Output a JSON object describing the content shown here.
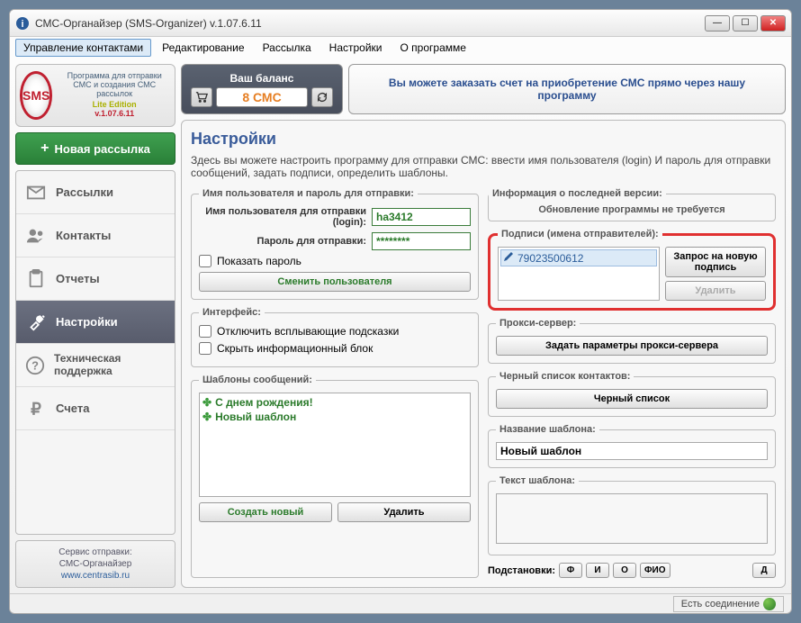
{
  "window": {
    "title": "СМС-Органайзер (SMS-Organizer) v.1.07.6.11"
  },
  "menu": {
    "contacts": "Управление контактами",
    "edit": "Редактирование",
    "send": "Рассылка",
    "settings": "Настройки",
    "about": "О программе"
  },
  "sidebar": {
    "logo": {
      "badge": "SMS",
      "desc": "Программа для отправки СМС и создания СМС рассылок",
      "edition": "Lite Edition",
      "version": "v.1.07.6.11"
    },
    "new_campaign": "Новая рассылка",
    "items": [
      {
        "label": "Рассылки"
      },
      {
        "label": "Контакты"
      },
      {
        "label": "Отчеты"
      },
      {
        "label": "Настройки"
      },
      {
        "label": "Техническая поддержка"
      },
      {
        "label": "Счета"
      }
    ],
    "service": {
      "l1": "Сервис отправки:",
      "l2": "СМС-Органайзер",
      "l3": "www.centrasib.ru"
    }
  },
  "top": {
    "balance_label": "Ваш баланс",
    "balance_value": "8 СМС",
    "order_text": "Вы можете заказать счет на приобретение СМС прямо через нашу программу"
  },
  "settings": {
    "heading": "Настройки",
    "desc": "Здесь вы можете настроить программу для отправки СМС: ввести имя пользователя (login) И пароль для отправки сообщений, задать подписи, определить шаблоны.",
    "creds": {
      "legend": "Имя пользователя и пароль для отправки:",
      "login_label": "Имя пользователя для отправки (login):",
      "login_value": "ha3412",
      "pass_label": "Пароль для отправки:",
      "pass_value": "********",
      "show_pass": "Показать пароль",
      "change_user": "Сменить пользователя"
    },
    "ui": {
      "legend": "Интерфейс:",
      "disable_tips": "Отключить всплывающие подсказки",
      "hide_info": "Скрыть информационный блок"
    },
    "templates": {
      "legend": "Шаблоны сообщений:",
      "items": [
        "С днем рождения!",
        "Новый шаблон"
      ],
      "create": "Создать новый",
      "delete": "Удалить"
    },
    "version": {
      "legend": "Информация о последней версии:",
      "text": "Обновление программы не требуется"
    },
    "signatures": {
      "legend": "Подписи (имена отправителей):",
      "items": [
        "79023500612"
      ],
      "request": "Запрос на новую подпись",
      "delete": "Удалить"
    },
    "proxy": {
      "legend": "Прокси-сервер:",
      "btn": "Задать параметры прокси-сервера"
    },
    "blacklist": {
      "legend": "Черный список контактов:",
      "btn": "Черный список"
    },
    "tpl_name": {
      "legend": "Название шаблона:",
      "value": "Новый шаблон"
    },
    "tpl_text": {
      "legend": "Текст шаблона:"
    },
    "subst": {
      "label": "Подстановки:",
      "f": "Ф",
      "i": "И",
      "o": "О",
      "fio": "ФИО",
      "d": "Д"
    }
  },
  "status": {
    "connection": "Есть соединение"
  }
}
